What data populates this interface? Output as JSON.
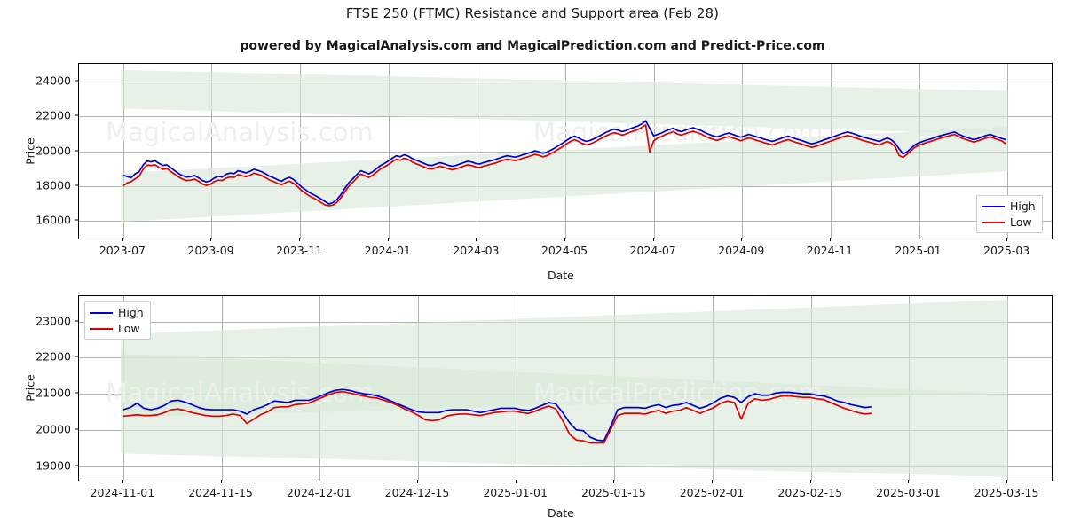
{
  "header": {
    "title": "FTSE 250 (FTMC) Resistance and Support area (Feb 28)",
    "subtitle": "powered by MagicalAnalysis.com and MagicalPrediction.com and Predict-Price.com"
  },
  "watermarks": {
    "left": "MagicalAnalysis.com",
    "right": "MagicalPrediction.com"
  },
  "colors": {
    "high": "#0000cc",
    "low": "#e00000",
    "band": "#d9e8d9",
    "grid": "#b0b0b0",
    "axis": "#000000",
    "watermark": "#eef0ee"
  },
  "legend": {
    "entries": [
      {
        "label": "High",
        "color": "#0000cc"
      },
      {
        "label": "Low",
        "color": "#e00000"
      }
    ]
  },
  "chart_data": [
    {
      "id": "upper",
      "type": "line",
      "title": "FTSE 250 (FTMC) Resistance and Support area (Feb 28)",
      "xlabel": "Date",
      "ylabel": "Price",
      "ylim": [
        15000,
        25000
      ],
      "yticks": [
        16000,
        18000,
        20000,
        22000,
        24000
      ],
      "ytick_labels": [
        "16000",
        "18000",
        "20000",
        "22000",
        "24000"
      ],
      "xlim": [
        "2023-06-20",
        "2025-03-20"
      ],
      "xticks": [
        "2023-07",
        "2023-09",
        "2023-11",
        "2024-01",
        "2024-03",
        "2024-05",
        "2024-07",
        "2024-09",
        "2024-11",
        "2025-01",
        "2025-03"
      ],
      "grid": true,
      "legend_position": "lower right",
      "bands": [
        {
          "name": "resistance-area",
          "x_start_frac": 0.043,
          "x_end_frac": 0.955,
          "y_left_top": 24650,
          "y_left_bottom": 22450,
          "y_right_top": 23450,
          "y_right_bottom": 20950
        },
        {
          "name": "support-area",
          "x_start_frac": 0.043,
          "x_end_frac": 0.955,
          "y_left_top": 18750,
          "y_left_bottom": 15950,
          "y_right_top": 21400,
          "y_right_bottom": 18850
        }
      ],
      "series": [
        {
          "name": "High",
          "color": "#0000cc",
          "values": [
            18620,
            18550,
            18480,
            18700,
            18820,
            19200,
            19440,
            19390,
            19460,
            19300,
            19180,
            19220,
            19050,
            18880,
            18720,
            18600,
            18520,
            18540,
            18610,
            18480,
            18320,
            18240,
            18300,
            18460,
            18560,
            18520,
            18680,
            18750,
            18710,
            18880,
            18820,
            18760,
            18840,
            18960,
            18900,
            18820,
            18700,
            18560,
            18480,
            18360,
            18280,
            18420,
            18500,
            18380,
            18180,
            17960,
            17800,
            17640,
            17520,
            17400,
            17260,
            17120,
            16980,
            17060,
            17240,
            17520,
            17880,
            18200,
            18420,
            18660,
            18880,
            18800,
            18700,
            18820,
            19000,
            19180,
            19300,
            19440,
            19600,
            19740,
            19680,
            19800,
            19720,
            19580,
            19480,
            19390,
            19300,
            19200,
            19180,
            19260,
            19340,
            19280,
            19200,
            19140,
            19180,
            19260,
            19340,
            19420,
            19380,
            19300,
            19260,
            19340,
            19400,
            19460,
            19520,
            19600,
            19680,
            19740,
            19700,
            19660,
            19720,
            19800,
            19860,
            19940,
            20020,
            19960,
            19880,
            19940,
            20060,
            20180,
            20320,
            20460,
            20620,
            20760,
            20860,
            20760,
            20640,
            20560,
            20620,
            20720,
            20840,
            20960,
            21080,
            21180,
            21260,
            21200,
            21120,
            21180,
            21280,
            21360,
            21440,
            21560,
            21740,
            21300,
            20880,
            20960,
            21040,
            21160,
            21240,
            21320,
            21180,
            21120,
            21200,
            21280,
            21340,
            21260,
            21180,
            21060,
            20960,
            20880,
            20820,
            20900,
            20980,
            21040,
            20960,
            20880,
            20800,
            20880,
            20960,
            20900,
            20820,
            20760,
            20680,
            20620,
            20560,
            20640,
            20720,
            20800,
            20860,
            20780,
            20700,
            20640,
            20560,
            20480,
            20420,
            20480,
            20560,
            20640,
            20720,
            20800,
            20880,
            20960,
            21040,
            21100,
            21040,
            20960,
            20880,
            20800,
            20740,
            20680,
            20620,
            20560,
            20660,
            20760,
            20660,
            20460,
            20140,
            19840,
            19960,
            20160,
            20360,
            20480,
            20560,
            20640,
            20700,
            20780,
            20860,
            20920,
            20980,
            21040,
            21100,
            20980,
            20880,
            20800,
            20720,
            20660,
            20740,
            20820,
            20900,
            20960,
            20880,
            20800,
            20720,
            20660
          ]
        },
        {
          "name": "Low",
          "color": "#e00000",
          "values": [
            18020,
            18180,
            18260,
            18420,
            18560,
            18960,
            19200,
            19180,
            19220,
            19080,
            18960,
            19000,
            18840,
            18680,
            18520,
            18400,
            18320,
            18340,
            18400,
            18280,
            18120,
            18040,
            18100,
            18260,
            18340,
            18320,
            18460,
            18520,
            18500,
            18660,
            18600,
            18540,
            18620,
            18740,
            18680,
            18600,
            18480,
            18340,
            18260,
            18160,
            18080,
            18200,
            18280,
            18160,
            17980,
            17760,
            17600,
            17440,
            17320,
            17200,
            17060,
            16920,
            16880,
            16920,
            17080,
            17340,
            17680,
            18000,
            18220,
            18460,
            18680,
            18600,
            18500,
            18620,
            18800,
            18980,
            19100,
            19240,
            19400,
            19540,
            19480,
            19600,
            19520,
            19380,
            19280,
            19190,
            19100,
            19000,
            18980,
            19060,
            19140,
            19080,
            19000,
            18940,
            18980,
            19060,
            19140,
            19220,
            19180,
            19100,
            19060,
            19140,
            19200,
            19260,
            19320,
            19400,
            19480,
            19540,
            19500,
            19460,
            19520,
            19600,
            19660,
            19740,
            19820,
            19760,
            19680,
            19740,
            19860,
            19980,
            20120,
            20260,
            20420,
            20560,
            20660,
            20560,
            20440,
            20360,
            20420,
            20520,
            20640,
            20760,
            20880,
            20980,
            21060,
            21000,
            20920,
            20980,
            21080,
            21160,
            21240,
            21360,
            21500,
            19960,
            20580,
            20760,
            20840,
            20960,
            21040,
            21120,
            20980,
            20920,
            21000,
            21080,
            21140,
            21060,
            20980,
            20860,
            20760,
            20680,
            20620,
            20700,
            20780,
            20840,
            20760,
            20680,
            20600,
            20680,
            20760,
            20700,
            20620,
            20560,
            20480,
            20420,
            20360,
            20440,
            20520,
            20600,
            20660,
            20580,
            20500,
            20440,
            20360,
            20280,
            20220,
            20280,
            20360,
            20440,
            20520,
            20600,
            20680,
            20760,
            20840,
            20900,
            20840,
            20760,
            20680,
            20600,
            20540,
            20480,
            20420,
            20360,
            20460,
            20560,
            20460,
            20260,
            19760,
            19640,
            19820,
            20020,
            20220,
            20340,
            20420,
            20500,
            20560,
            20640,
            20720,
            20780,
            20840,
            20900,
            20960,
            20840,
            20740,
            20660,
            20580,
            20520,
            20600,
            20680,
            20760,
            20820,
            20740,
            20660,
            20580,
            20420
          ]
        }
      ]
    },
    {
      "id": "lower",
      "type": "line",
      "xlabel": "Date",
      "ylabel": "Price",
      "ylim": [
        18600,
        23700
      ],
      "yticks": [
        19000,
        20000,
        21000,
        22000,
        23000
      ],
      "ytick_labels": [
        "19000",
        "20000",
        "21000",
        "22000",
        "23000"
      ],
      "xlim": [
        "2024-10-25",
        "2025-03-20"
      ],
      "xticks": [
        "2024-11-01",
        "2024-11-15",
        "2024-12-01",
        "2024-12-15",
        "2025-01-01",
        "2025-01-15",
        "2025-02-01",
        "2025-02-15",
        "2025-03-01",
        "2025-03-15"
      ],
      "grid": true,
      "legend_position": "upper left",
      "bands": [
        {
          "name": "resistance-area",
          "x_start_frac": 0.043,
          "x_end_frac": 0.955,
          "y_left_top": 22650,
          "y_left_bottom": 20350,
          "y_right_top": 23600,
          "y_right_bottom": 21000
        },
        {
          "name": "support-area",
          "x_start_frac": 0.043,
          "x_end_frac": 0.955,
          "y_left_top": 22100,
          "y_left_bottom": 19350,
          "y_right_top": 21000,
          "y_right_bottom": 18700
        }
      ],
      "series": [
        {
          "name": "High",
          "color": "#0000cc",
          "values": [
            20560,
            20620,
            20740,
            20600,
            20560,
            20600,
            20680,
            20800,
            20820,
            20770,
            20700,
            20620,
            20570,
            20560,
            20560,
            20560,
            20560,
            20520,
            20440,
            20560,
            20620,
            20700,
            20800,
            20780,
            20760,
            20820,
            20820,
            20820,
            20880,
            20960,
            21040,
            21100,
            21120,
            21090,
            21040,
            21000,
            20980,
            20940,
            20880,
            20800,
            20720,
            20640,
            20560,
            20500,
            20480,
            20480,
            20480,
            20540,
            20560,
            20560,
            20560,
            20520,
            20480,
            20520,
            20560,
            20600,
            20600,
            20600,
            20560,
            20540,
            20600,
            20680,
            20760,
            20720,
            20480,
            20200,
            20000,
            19980,
            19800,
            19720,
            19700,
            20100,
            20560,
            20620,
            20620,
            20620,
            20600,
            20660,
            20700,
            20620,
            20680,
            20700,
            20760,
            20680,
            20600,
            20660,
            20760,
            20880,
            20940,
            20900,
            20760,
            20920,
            21000,
            20960,
            20960,
            21020,
            21040,
            21040,
            21020,
            21000,
            21000,
            20960,
            20940,
            20880,
            20800,
            20760,
            20700,
            20660,
            20620,
            20640
          ]
        },
        {
          "name": "Low",
          "color": "#e00000",
          "values": [
            20380,
            20400,
            20420,
            20400,
            20400,
            20420,
            20480,
            20560,
            20580,
            20540,
            20480,
            20440,
            20400,
            20380,
            20380,
            20400,
            20440,
            20400,
            20180,
            20300,
            20420,
            20500,
            20620,
            20640,
            20640,
            20700,
            20720,
            20740,
            20820,
            20900,
            20980,
            21040,
            21060,
            21020,
            20980,
            20940,
            20900,
            20880,
            20820,
            20760,
            20680,
            20580,
            20500,
            20400,
            20280,
            20260,
            20280,
            20380,
            20420,
            20440,
            20440,
            20420,
            20400,
            20440,
            20480,
            20500,
            20520,
            20520,
            20480,
            20460,
            20520,
            20600,
            20660,
            20580,
            20260,
            19880,
            19720,
            19700,
            19640,
            19640,
            19640,
            20020,
            20400,
            20460,
            20460,
            20460,
            20440,
            20500,
            20540,
            20460,
            20520,
            20540,
            20620,
            20540,
            20460,
            20540,
            20620,
            20740,
            20800,
            20760,
            20300,
            20740,
            20860,
            20820,
            20840,
            20900,
            20940,
            20940,
            20920,
            20900,
            20900,
            20860,
            20840,
            20760,
            20680,
            20600,
            20540,
            20480,
            20440,
            20460
          ]
        }
      ]
    }
  ]
}
